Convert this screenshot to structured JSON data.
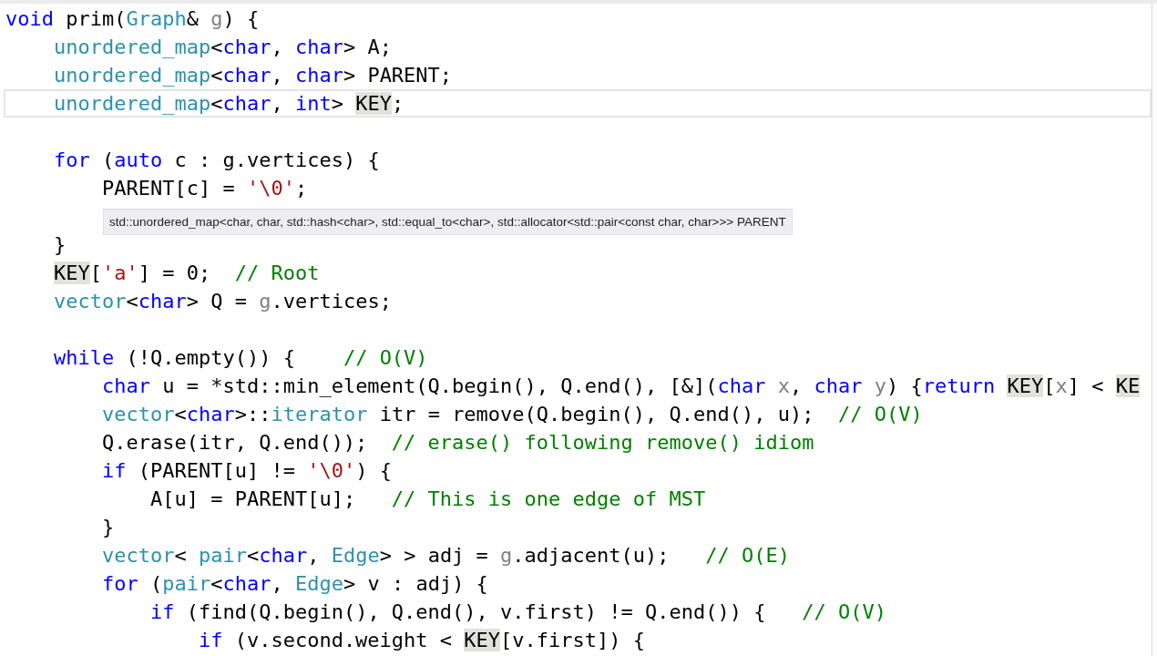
{
  "editor": {
    "lines": [
      {
        "current": false,
        "tokens": [
          {
            "text": "void",
            "kind": "keyword"
          },
          {
            "text": " prim(",
            "kind": "plain"
          },
          {
            "text": "Graph",
            "kind": "type"
          },
          {
            "text": "& ",
            "kind": "plain"
          },
          {
            "text": "g",
            "kind": "param"
          },
          {
            "text": ") {",
            "kind": "plain"
          }
        ]
      },
      {
        "current": false,
        "tokens": [
          {
            "text": "    unordered_map",
            "kind": "type"
          },
          {
            "text": "<",
            "kind": "plain"
          },
          {
            "text": "char",
            "kind": "keyword"
          },
          {
            "text": ", ",
            "kind": "plain"
          },
          {
            "text": "char",
            "kind": "keyword"
          },
          {
            "text": "> A;",
            "kind": "plain"
          }
        ]
      },
      {
        "current": false,
        "tokens": [
          {
            "text": "    unordered_map",
            "kind": "type"
          },
          {
            "text": "<",
            "kind": "plain"
          },
          {
            "text": "char",
            "kind": "keyword"
          },
          {
            "text": ", ",
            "kind": "plain"
          },
          {
            "text": "char",
            "kind": "keyword"
          },
          {
            "text": "> PARENT;",
            "kind": "plain"
          }
        ]
      },
      {
        "current": true,
        "tokens": [
          {
            "text": "    unordered_map",
            "kind": "type"
          },
          {
            "text": "<",
            "kind": "plain"
          },
          {
            "text": "char",
            "kind": "keyword"
          },
          {
            "text": ", ",
            "kind": "plain"
          },
          {
            "text": "int",
            "kind": "keyword"
          },
          {
            "text": "> ",
            "kind": "plain"
          },
          {
            "text": "KEY",
            "kind": "ref"
          },
          {
            "text": ";",
            "kind": "plain"
          }
        ]
      },
      {
        "current": false
      },
      {
        "current": false,
        "tokens": [
          {
            "text": "    for",
            "kind": "keyword"
          },
          {
            "text": " (",
            "kind": "plain"
          },
          {
            "text": "auto",
            "kind": "keyword"
          },
          {
            "text": " c : g.vertices) {",
            "kind": "plain"
          }
        ]
      },
      {
        "current": false,
        "tokens": [
          {
            "text": "        PARENT[c] = ",
            "kind": "plain"
          },
          {
            "text": "'\\0'",
            "kind": "string"
          },
          {
            "text": ";",
            "kind": "plain"
          }
        ]
      },
      {
        "current": false
      },
      {
        "current": false,
        "tokens": [
          {
            "text": "    }",
            "kind": "plain"
          }
        ]
      },
      {
        "current": false,
        "tokens": [
          {
            "text": "    KEY",
            "kind": "ref"
          },
          {
            "text": "[",
            "kind": "plain"
          },
          {
            "text": "'a'",
            "kind": "string"
          },
          {
            "text": "] = 0;  ",
            "kind": "plain"
          },
          {
            "text": "// Root",
            "kind": "comment"
          }
        ]
      },
      {
        "current": false,
        "tokens": [
          {
            "text": "    vector",
            "kind": "type"
          },
          {
            "text": "<",
            "kind": "plain"
          },
          {
            "text": "char",
            "kind": "keyword"
          },
          {
            "text": "> Q = ",
            "kind": "plain"
          },
          {
            "text": "g",
            "kind": "param"
          },
          {
            "text": ".vertices;",
            "kind": "plain"
          }
        ]
      },
      {
        "current": false
      },
      {
        "current": false,
        "tokens": [
          {
            "text": "    while",
            "kind": "keyword"
          },
          {
            "text": " (!Q.empty()) {    ",
            "kind": "plain"
          },
          {
            "text": "// O(V)",
            "kind": "comment"
          }
        ]
      },
      {
        "current": false,
        "tokens": [
          {
            "text": "        char",
            "kind": "keyword"
          },
          {
            "text": " u = *std::min_element(Q.begin(), Q.end(), [&](",
            "kind": "plain"
          },
          {
            "text": "char",
            "kind": "keyword"
          },
          {
            "text": " x",
            "kind": "param"
          },
          {
            "text": ", ",
            "kind": "plain"
          },
          {
            "text": "char",
            "kind": "keyword"
          },
          {
            "text": " y",
            "kind": "param"
          },
          {
            "text": ") {",
            "kind": "plain"
          },
          {
            "text": "return ",
            "kind": "keyword"
          },
          {
            "text": "KEY",
            "kind": "ref"
          },
          {
            "text": "[",
            "kind": "plain"
          },
          {
            "text": "x",
            "kind": "param"
          },
          {
            "text": "] < ",
            "kind": "plain"
          },
          {
            "text": "KE",
            "kind": "ref"
          }
        ]
      },
      {
        "current": false,
        "tokens": [
          {
            "text": "        vector",
            "kind": "type"
          },
          {
            "text": "<",
            "kind": "plain"
          },
          {
            "text": "char",
            "kind": "keyword"
          },
          {
            "text": ">::",
            "kind": "plain"
          },
          {
            "text": "iterator",
            "kind": "type"
          },
          {
            "text": " itr = remove(Q.begin(), Q.end(), u);  ",
            "kind": "plain"
          },
          {
            "text": "// O(V)",
            "kind": "comment"
          }
        ]
      },
      {
        "current": false,
        "tokens": [
          {
            "text": "        Q.erase(itr, Q.end());  ",
            "kind": "plain"
          },
          {
            "text": "// erase() following remove() idiom",
            "kind": "comment"
          }
        ]
      },
      {
        "current": false,
        "tokens": [
          {
            "text": "        if",
            "kind": "keyword"
          },
          {
            "text": " (PARENT[u] != ",
            "kind": "plain"
          },
          {
            "text": "'\\0'",
            "kind": "string"
          },
          {
            "text": ") {",
            "kind": "plain"
          }
        ]
      },
      {
        "current": false,
        "tokens": [
          {
            "text": "            A[u] = PARENT[u];   ",
            "kind": "plain"
          },
          {
            "text": "// This is one edge of MST",
            "kind": "comment"
          }
        ]
      },
      {
        "current": false,
        "tokens": [
          {
            "text": "        }",
            "kind": "plain"
          }
        ]
      },
      {
        "current": false,
        "tokens": [
          {
            "text": "        vector",
            "kind": "type"
          },
          {
            "text": "< ",
            "kind": "plain"
          },
          {
            "text": "pair",
            "kind": "type"
          },
          {
            "text": "<",
            "kind": "plain"
          },
          {
            "text": "char",
            "kind": "keyword"
          },
          {
            "text": ", ",
            "kind": "plain"
          },
          {
            "text": "Edge",
            "kind": "type"
          },
          {
            "text": "> > adj = ",
            "kind": "plain"
          },
          {
            "text": "g",
            "kind": "param"
          },
          {
            "text": ".adjacent(u);   ",
            "kind": "plain"
          },
          {
            "text": "// O(E)",
            "kind": "comment"
          }
        ]
      },
      {
        "current": false,
        "tokens": [
          {
            "text": "        for",
            "kind": "keyword"
          },
          {
            "text": " (",
            "kind": "plain"
          },
          {
            "text": "pair",
            "kind": "type"
          },
          {
            "text": "<",
            "kind": "plain"
          },
          {
            "text": "char",
            "kind": "keyword"
          },
          {
            "text": ", ",
            "kind": "plain"
          },
          {
            "text": "Edge",
            "kind": "type"
          },
          {
            "text": "> v : adj) {",
            "kind": "plain"
          }
        ]
      },
      {
        "current": false,
        "tokens": [
          {
            "text": "            if",
            "kind": "keyword"
          },
          {
            "text": " (find(Q.begin(), Q.end(), v.first) != Q.end()) {   ",
            "kind": "plain"
          },
          {
            "text": "// O(V)",
            "kind": "comment"
          }
        ]
      },
      {
        "current": false,
        "tokens": [
          {
            "text": "                if",
            "kind": "keyword"
          },
          {
            "text": " (v.second.weight < ",
            "kind": "plain"
          },
          {
            "text": "KEY",
            "kind": "ref"
          },
          {
            "text": "[v.first]) {",
            "kind": "plain"
          }
        ]
      }
    ],
    "tooltip": {
      "text": "std::unordered_map<char, char, std::hash<char>, std::equal_to<char>, std::allocator<std::pair<const char, char>>> PARENT"
    }
  }
}
